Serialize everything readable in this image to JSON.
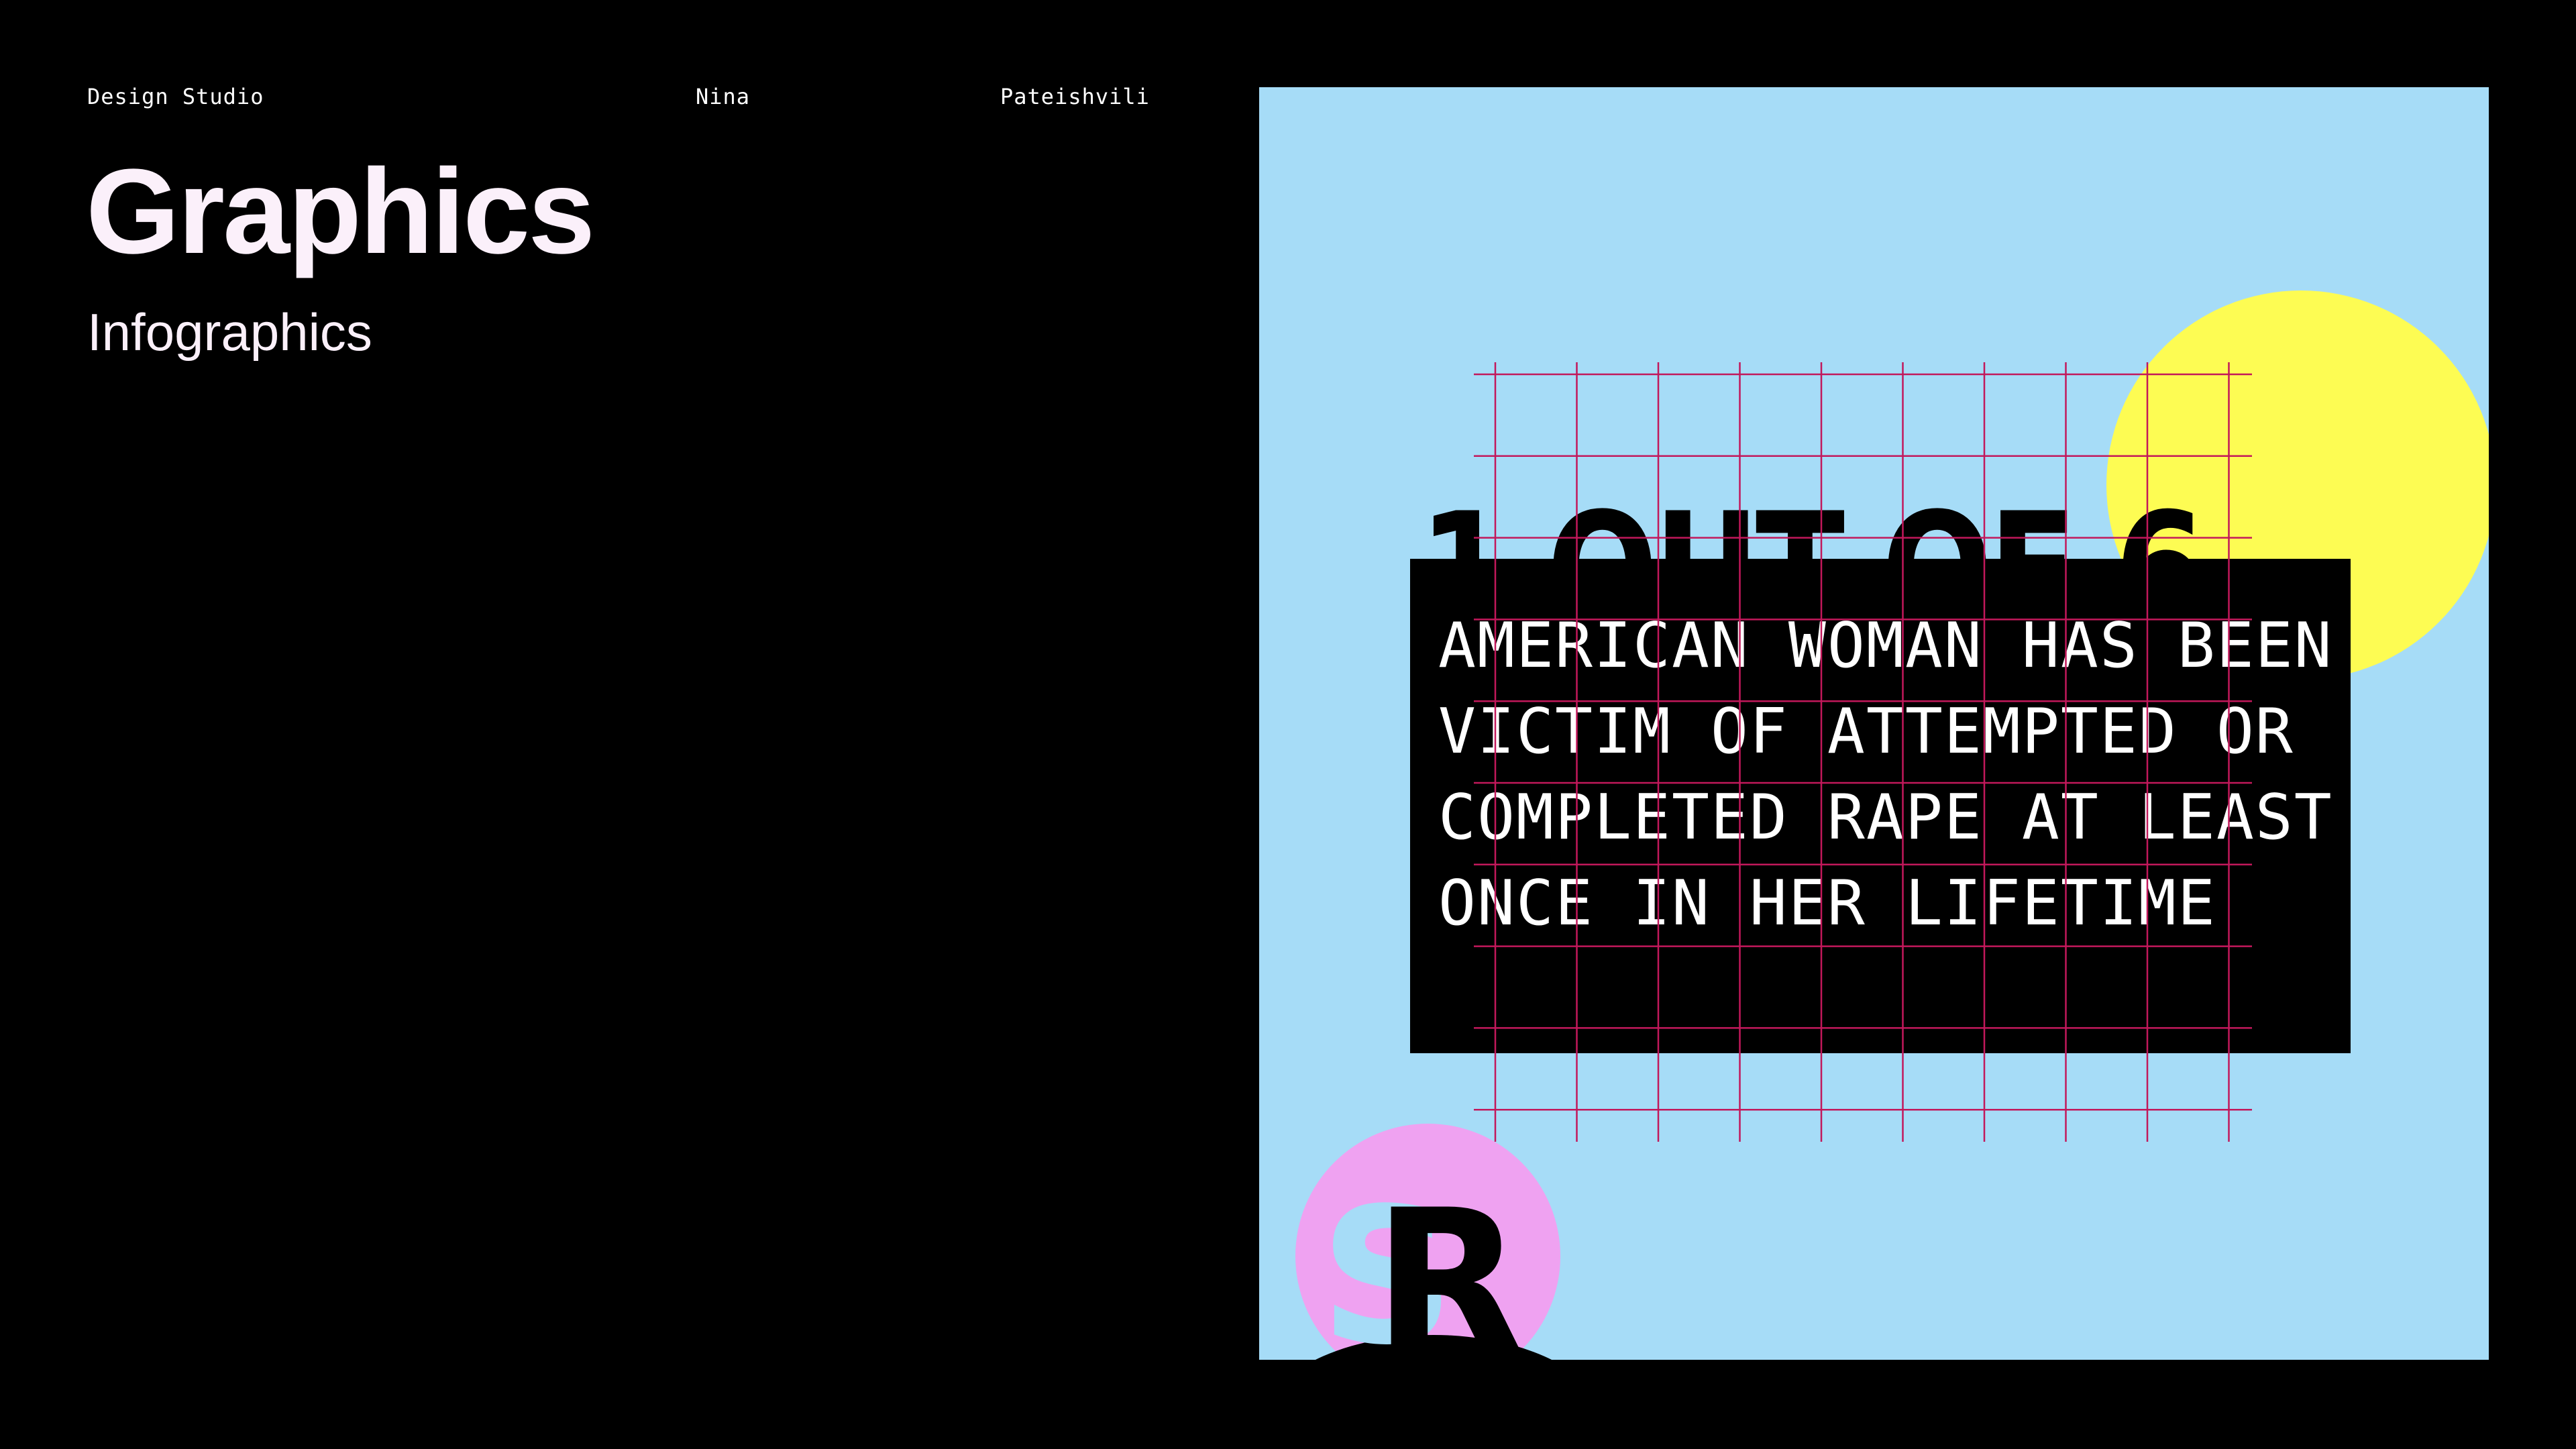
{
  "header": {
    "studio": "Design Studio",
    "first_name": "Nina",
    "last_name": "Pateishvili"
  },
  "page": {
    "title": "Graphics",
    "subtitle": "Infographics"
  },
  "poster": {
    "headline": "1 OUT OF 6",
    "body_lines": [
      "AMERICAN WOMAN HAS BEEN",
      "VICTIM OF ATTEMPTED OR",
      "COMPLETED RAPE AT LEAST",
      "ONCE IN HER LIFETIME"
    ],
    "logo_letters": "SR",
    "colors": {
      "background": "#a6dcf7",
      "yellow_circle": "#fdfc53",
      "pink_circle": "#efa2f1",
      "grid_lines": "#c2185b",
      "panel": "#000000"
    }
  },
  "colors": {
    "page_background": "#000000",
    "title_text": "#fbf0fa"
  }
}
